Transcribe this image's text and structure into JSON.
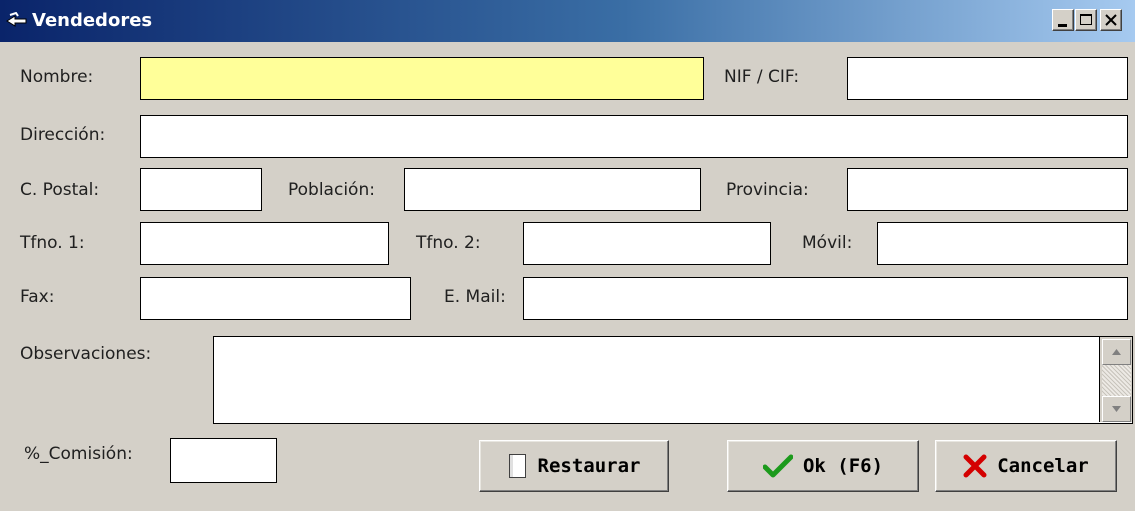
{
  "window": {
    "title": "Vendedores"
  },
  "labels": {
    "nombre": "Nombre:",
    "nif": "NIF / CIF:",
    "direccion": "Dirección:",
    "cpostal": "C. Postal:",
    "poblacion": "Población:",
    "provincia": "Provincia:",
    "tfno1": "Tfno. 1:",
    "tfno2": "Tfno. 2:",
    "movil": "Móvil:",
    "fax": "Fax:",
    "email": "E. Mail:",
    "observaciones": "Observaciones:",
    "comision": "%_Comisión:"
  },
  "fields": {
    "nombre": "",
    "nif": "",
    "direccion": "",
    "cpostal": "",
    "poblacion": "",
    "provincia": "",
    "tfno1": "",
    "tfno2": "",
    "movil": "",
    "fax": "",
    "email": "",
    "observaciones": "",
    "comision": ""
  },
  "buttons": {
    "restaurar": "Restaurar",
    "ok": "Ok (F6)",
    "cancelar": "Cancelar"
  },
  "colors": {
    "required_field": "#ffff99",
    "title_gradient_start": "#0a246a"
  }
}
